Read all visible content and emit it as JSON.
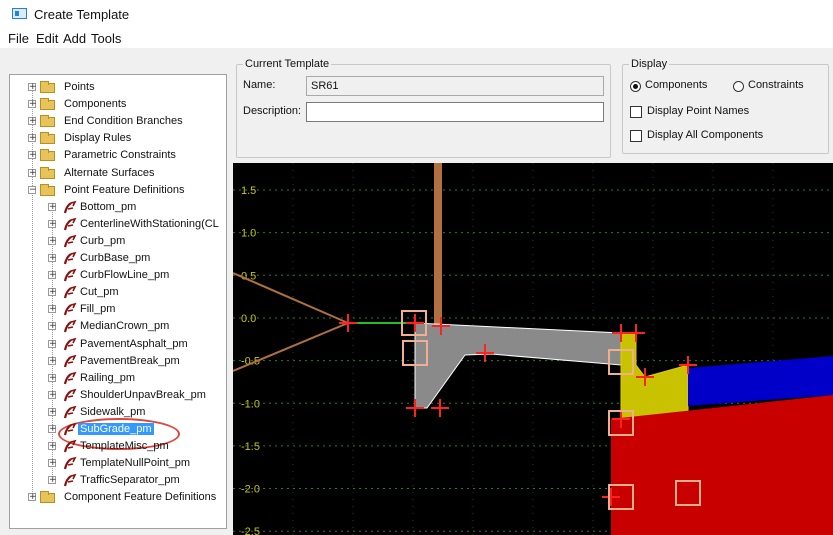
{
  "window": {
    "title": "Create Template"
  },
  "menu": [
    "File",
    "Edit",
    "Add",
    "Tools"
  ],
  "tree": {
    "top_folders": [
      "Points",
      "Components",
      "End Condition Branches",
      "Display Rules",
      "Parametric Constraints",
      "Alternate Surfaces",
      "Point Feature Definitions"
    ],
    "point_features": [
      "Bottom_pm",
      "CenterlineWithStationing(CL",
      "Curb_pm",
      "CurbBase_pm",
      "CurbFlowLine_pm",
      "Cut_pm",
      "Fill_pm",
      "MedianCrown_pm",
      "PavementAsphalt_pm",
      "PavementBreak_pm",
      "Railing_pm",
      "ShoulderUnpavBreak_pm",
      "Sidewalk_pm",
      "SubGrade_pm",
      "TemplateMisc_pm",
      "TemplateNullPoint_pm",
      "TrafficSeparator_pm"
    ],
    "selected_index": 13,
    "last_folder": "Component Feature Definitions"
  },
  "current_template": {
    "group_label": "Current Template",
    "name_label": "Name:",
    "name_value": "SR61",
    "description_label": "Description:",
    "description_value": ""
  },
  "display": {
    "group_label": "Display",
    "radio_components": "Components",
    "radio_constraints": "Constraints",
    "selected_radio": "Components",
    "check_point_names": "Display Point Names",
    "check_point_names_checked": false,
    "check_all_components": "Display All Components",
    "check_all_components_checked": false
  },
  "canvas": {
    "y_ticks": [
      "1.5",
      "1.0",
      "0.5",
      "0.0",
      "-0.5",
      "-1.0",
      "-1.5",
      "-2.0",
      "-2.5"
    ],
    "colors": {
      "background": "#000000",
      "grid": "#2f7a2f",
      "tick_label": "#c8c800",
      "pavement": "#8a8a8a",
      "curb": "#c8c200",
      "subbase": "#c80000",
      "shoulder": "#0000c8",
      "point_marker": "#ff2020",
      "end_condition": "#b07040",
      "selection_box": "#f0b090"
    }
  }
}
